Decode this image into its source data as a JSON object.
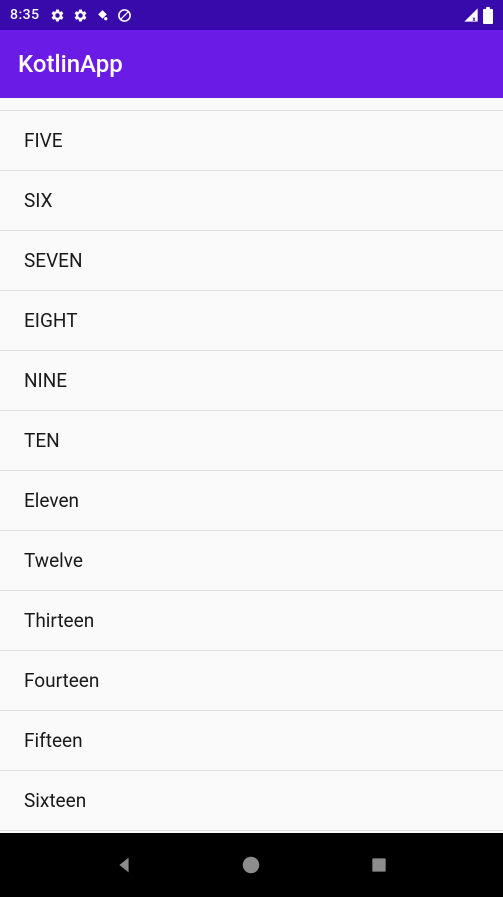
{
  "statusBar": {
    "time": "8:35"
  },
  "appBar": {
    "title": "KotlinApp"
  },
  "list": {
    "items": [
      "FIVE",
      "SIX",
      "SEVEN",
      "EIGHT",
      "NINE",
      "TEN",
      "Eleven",
      "Twelve",
      "Thirteen",
      "Fourteen",
      "Fifteen",
      "Sixteen"
    ]
  }
}
